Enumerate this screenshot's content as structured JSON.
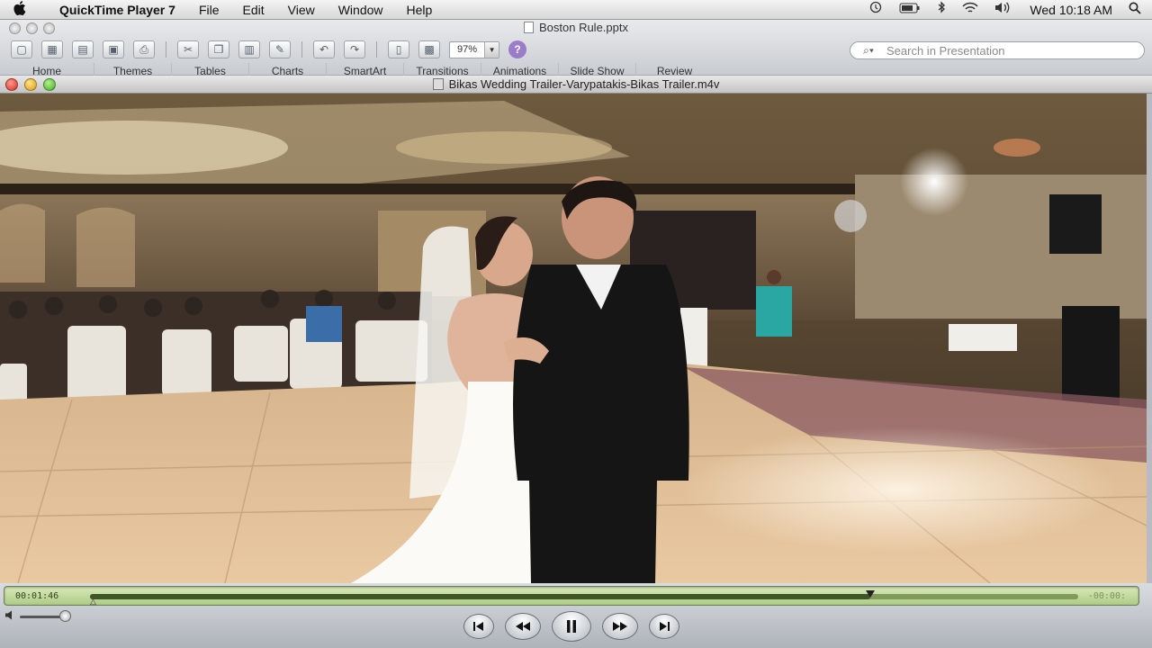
{
  "menubar": {
    "apple": "",
    "items": [
      "QuickTime Player 7",
      "File",
      "Edit",
      "View",
      "Window",
      "Help"
    ],
    "clock": "Wed 10:18 AM"
  },
  "powerpoint": {
    "title": "Boston Rule.pptx",
    "zoom": "97%",
    "search_placeholder": "Search in Presentation",
    "ribbon_tabs": [
      "Home",
      "Themes",
      "Tables",
      "Charts",
      "SmartArt",
      "Transitions",
      "Animations",
      "Slide Show",
      "Review"
    ]
  },
  "quicktime": {
    "title": "Bikas Wedding Trailer-Varypatakis-Bikas Trailer.m4v",
    "time_elapsed": "00:01:46",
    "time_remaining": "-00:00:",
    "progress": 0.79,
    "volume": 0.9,
    "controls": {
      "jump_start": "⏮",
      "rewind": "⏪",
      "play_pause": "⏸",
      "fast_forward": "⏩",
      "jump_end": "⏭"
    }
  },
  "colors": {
    "lcd": "#bcd59a",
    "window_bg": "#cfd3d8"
  }
}
